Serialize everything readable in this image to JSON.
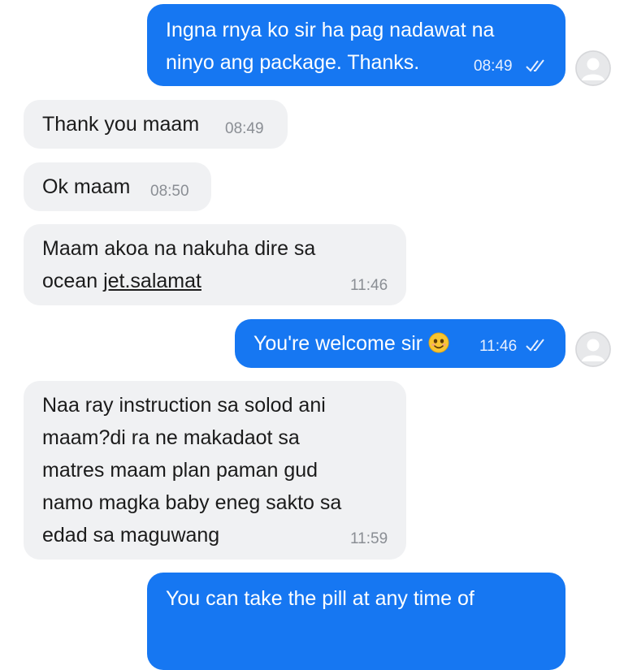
{
  "messages": [
    {
      "dir": "out",
      "lines": "Ingna rnya ko sir ha pag nadawat na\nninyo ang package. Thanks.",
      "time": "08:49",
      "status": "read"
    },
    {
      "dir": "in",
      "text": "Thank you maam",
      "time": "08:49"
    },
    {
      "dir": "in",
      "text": "Ok maam",
      "time": "08:50"
    },
    {
      "dir": "in",
      "line1": "Maam akoa na nakuha dire sa",
      "line2_prefix": "ocean ",
      "line2_link": "jet.salamat",
      "time": "11:46"
    },
    {
      "dir": "out",
      "text": "You're welcome sir",
      "emoji": "smiling-face",
      "time": "11:46",
      "status": "read"
    },
    {
      "dir": "in",
      "lines": "Naa ray instruction sa solod ani\nmaam?di ra ne makadaot sa\nmatres maam plan paman gud\nnamo magka baby eneg sakto sa\nedad sa maguwang",
      "time": "11:59"
    },
    {
      "dir": "out",
      "lines": "You can take the pill at any time of",
      "time": ""
    }
  ],
  "colors": {
    "outgoing_bubble": "#1677f2",
    "incoming_bubble": "#f0f1f3"
  },
  "icons": {
    "read_receipt": "double-check-icon",
    "avatar": "default-avatar-icon"
  }
}
